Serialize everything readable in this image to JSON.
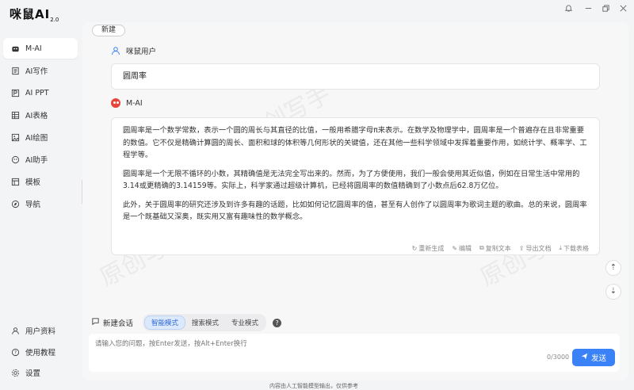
{
  "app": {
    "logo_text": "咪鼠AI",
    "logo_version": "2.0"
  },
  "window_controls": [
    "bell-icon",
    "minimize-icon",
    "restore-icon",
    "close-icon"
  ],
  "sidebar": {
    "items": [
      {
        "label": "M-AI",
        "icon": "mouse-icon",
        "active": true
      },
      {
        "label": "AI写作",
        "icon": "write-icon"
      },
      {
        "label": "AI PPT",
        "icon": "ppt-icon"
      },
      {
        "label": "AI表格",
        "icon": "table-icon"
      },
      {
        "label": "AI绘图",
        "icon": "image-icon"
      },
      {
        "label": "AI助手",
        "icon": "assistant-icon"
      },
      {
        "label": "模板",
        "icon": "template-icon"
      },
      {
        "label": "导航",
        "icon": "compass-icon"
      }
    ],
    "bottom_items": [
      {
        "label": "用户资料",
        "icon": "user-icon"
      },
      {
        "label": "使用教程",
        "icon": "help-icon"
      },
      {
        "label": "设置",
        "icon": "gear-icon"
      }
    ]
  },
  "toolbar": {
    "new_label": "新建"
  },
  "conversation": {
    "user_name": "咪鼠用户",
    "user_message": "圆周率",
    "ai_name": "M-AI",
    "ai_paragraphs": [
      "圆周率是一个数学常数，表示一个圆的周长与其直径的比值，一般用希腊字母π来表示。在数学及物理学中，圆周率是一个普遍存在且非常重要的数值。它不仅是精确计算圆的周长、面积和球的体积等几何形状的关键值，还在其他一些科学领域中发挥着重要作用，如统计学、概率学、工程学等。",
      "圆周率是一个无限不循环的小数，其精确值是无法完全写出来的。然而，为了方便使用，我们一般会使用其近似值，例如在日常生活中常用的3.14或更精确的3.14159等。实际上，科学家通过超级计算机，已经将圆周率的数值精确到了小数点后62.8万亿位。",
      "此外，关于圆周率的研究还涉及到许多有趣的话题，比如如何记忆圆周率的值，甚至有人创作了以圆周率为歌词主题的歌曲。总的来说，圆周率是一个既基础又深奥，既实用又富有趣味性的数学概念。"
    ],
    "actions": [
      {
        "label": "重新生成",
        "icon": "refresh-icon"
      },
      {
        "label": "编辑",
        "icon": "edit-icon"
      },
      {
        "label": "复制文本",
        "icon": "copy-icon"
      },
      {
        "label": "导出文档",
        "icon": "export-icon"
      },
      {
        "label": "下载表格",
        "icon": "download-icon"
      }
    ]
  },
  "composer": {
    "new_session_label": "新建会话",
    "modes": [
      {
        "label": "智能模式",
        "active": true
      },
      {
        "label": "搜索模式"
      },
      {
        "label": "专业模式"
      }
    ],
    "placeholder": "请输入您的问题，按Enter发送，按Alt+Enter换行",
    "counter": "0/3000",
    "send_label": "发送"
  },
  "watermark_text": "原创写手",
  "footer_note": "内容由人工智能模型输出，仅供参考",
  "colors": {
    "accent": "#3b82f6",
    "brand_red": "#e8443a",
    "active_mode": "#2b66d6"
  }
}
